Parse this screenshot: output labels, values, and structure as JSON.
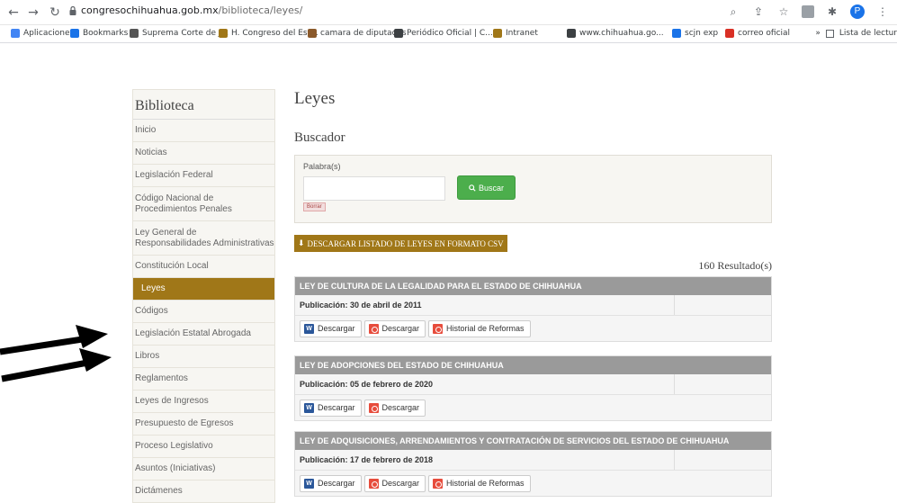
{
  "browser": {
    "url_host": "congresochihuahua.gob.mx",
    "url_path": "/biblioteca/leyes/",
    "avatar_letter": "P",
    "bookmarks": [
      {
        "label": "Aplicaciones",
        "icon": "apps-grid-icon",
        "color": "#4285f4"
      },
      {
        "label": "Bookmarks",
        "icon": "star-icon",
        "color": "#1a73e8"
      },
      {
        "label": "Suprema Corte de J...",
        "icon": "globe-icon",
        "color": "#555555"
      },
      {
        "label": "H. Congreso del Est...",
        "icon": "seal-icon",
        "color": "#a07718"
      },
      {
        "label": "camara de diputados",
        "icon": "camara-icon",
        "color": "#8b5a2b"
      },
      {
        "label": "Periódico Oficial | C...",
        "icon": "shield-icon",
        "color": "#3c4043"
      },
      {
        "label": "Intranet",
        "icon": "seal-icon",
        "color": "#a07718"
      },
      {
        "label": "www.chihuahua.go...",
        "icon": "shield-icon",
        "color": "#3c4043"
      },
      {
        "label": "scjn exp",
        "icon": "bird-icon",
        "color": "#1a73e8"
      },
      {
        "label": "correo oficial",
        "icon": "x-icon",
        "color": "#d93025"
      }
    ],
    "more": "»",
    "reading_list": "Lista de lectur"
  },
  "sidebar": {
    "title": "Biblioteca",
    "items": [
      {
        "label": "Inicio"
      },
      {
        "label": "Noticias"
      },
      {
        "label": "Legislación Federal"
      },
      {
        "label": "Código Nacional de Procedimientos Penales"
      },
      {
        "label": "Ley General de Responsabilidades Administrativas"
      },
      {
        "label": "Constitución Local"
      },
      {
        "label": "Leyes",
        "active": true
      },
      {
        "label": "Códigos"
      },
      {
        "label": "Legislación Estatal Abrogada"
      },
      {
        "label": "Libros"
      },
      {
        "label": "Reglamentos"
      },
      {
        "label": "Leyes de Ingresos"
      },
      {
        "label": "Presupuesto de Egresos"
      },
      {
        "label": "Proceso Legislativo"
      },
      {
        "label": "Asuntos (Iniciativas)"
      },
      {
        "label": "Dictámenes"
      }
    ]
  },
  "main": {
    "title": "Leyes",
    "search_heading": "Buscador",
    "search_label": "Palabra(s)",
    "search_value": "",
    "search_button": "Buscar",
    "clear_button": "Borrar",
    "csv_button": "DESCARGAR LISTADO DE LEYES EN FORMATO CSV",
    "results": "160 Resultado(s)",
    "laws": [
      {
        "title": "LEY DE CULTURA DE LA LEGALIDAD PARA EL ESTADO DE CHIHUAHUA",
        "publication": "Publicación: 30 de abril de 2011",
        "buttons": [
          "Descargar",
          "Descargar",
          "Historial de Reformas"
        ]
      },
      {
        "title": "LEY DE ADOPCIONES DEL ESTADO DE CHIHUAHUA",
        "publication": "Publicación: 05 de febrero de 2020",
        "buttons": [
          "Descargar",
          "Descargar"
        ]
      },
      {
        "title": "LEY DE ADQUISICIONES, ARRENDAMIENTOS Y CONTRATACIÓN DE SERVICIOS DEL ESTADO DE CHIHUAHUA",
        "publication": "Publicación: 17 de febrero de 2018",
        "buttons": [
          "Descargar",
          "Descargar",
          "Historial de Reformas"
        ]
      }
    ]
  },
  "colors": {
    "accent": "#a07718",
    "success": "#4cae4c",
    "law_header": "#9a9a9a"
  }
}
